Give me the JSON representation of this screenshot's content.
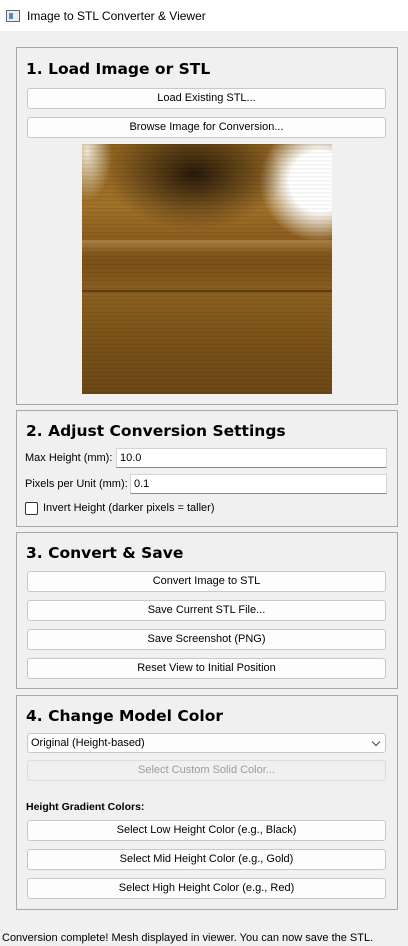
{
  "window": {
    "title": "Image to STL Converter & Viewer",
    "icon": "app-window-icon"
  },
  "section1": {
    "heading": "1. Load Image or STL",
    "load_stl": "Load Existing STL...",
    "browse_image": "Browse Image for Conversion..."
  },
  "section2": {
    "heading": "2. Adjust Conversion Settings",
    "max_height_label": "Max Height (mm):",
    "max_height_value": "10.0",
    "ppu_label": "Pixels per Unit (mm):",
    "ppu_value": "0.1",
    "invert_label": "Invert Height (darker pixels = taller)",
    "invert_checked": false
  },
  "section3": {
    "heading": "3. Convert & Save",
    "convert": "Convert Image to STL",
    "save_stl": "Save Current STL File...",
    "save_screenshot": "Save Screenshot (PNG)",
    "reset_view": "Reset View to Initial Position"
  },
  "section4": {
    "heading": "4. Change Model Color",
    "color_mode_selected": "Original (Height-based)",
    "custom_color": "Select Custom Solid Color...",
    "gradient_heading": "Height Gradient Colors:",
    "low_color": "Select Low Height Color (e.g., Black)",
    "mid_color": "Select Mid Height Color (e.g., Gold)",
    "high_color": "Select High Height Color (e.g., Red)"
  },
  "status": "Conversion complete! Mesh displayed in viewer. You can now save the STL."
}
